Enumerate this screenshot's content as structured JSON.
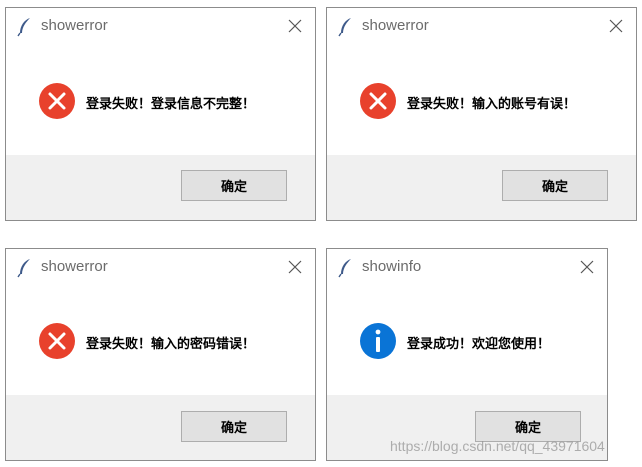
{
  "dialogs": [
    {
      "title": "showerror",
      "message": "登录失败！登录信息不完整！",
      "icon": "error-icon",
      "button_label": "确定"
    },
    {
      "title": "showerror",
      "message": "登录失败！输入的账号有误！",
      "icon": "error-icon",
      "button_label": "确定"
    },
    {
      "title": "showerror",
      "message": "登录失败！输入的密码错误！",
      "icon": "error-icon",
      "button_label": "确定"
    },
    {
      "title": "showinfo",
      "message": "登录成功！欢迎您使用！",
      "icon": "info-icon",
      "button_label": "确定"
    }
  ],
  "colors": {
    "error": "#e8412c",
    "info": "#0a74d6",
    "footer": "#f0f0f0",
    "button": "#e1e1e1",
    "title_text": "#6b6b6b",
    "feather": "#3e5a8a"
  },
  "watermark": "https://blog.csdn.net/qq_43971604"
}
